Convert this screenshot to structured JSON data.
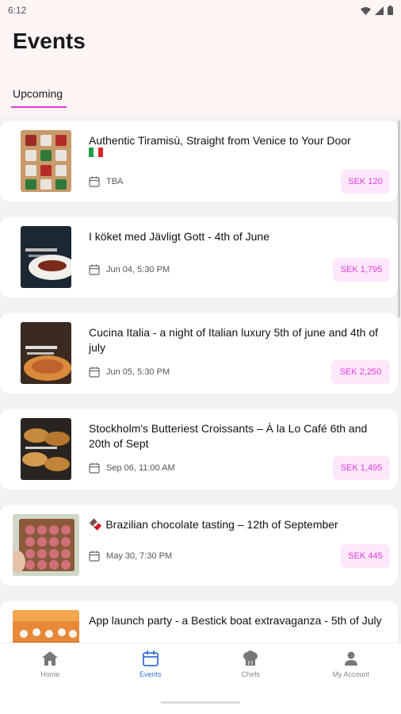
{
  "status_bar": {
    "time": "6:12"
  },
  "header": {
    "title": "Events",
    "tab_label": "Upcoming"
  },
  "events": [
    {
      "title": "Authentic Tiramisù, Straight from Venice to Your Door",
      "flag": "Italy flag",
      "date": "TBA",
      "price": "SEK 120"
    },
    {
      "title": "I köket med Jävligt Gott - 4th of June",
      "date": "Jun 04, 5:30 PM",
      "price": "SEK 1,795"
    },
    {
      "title": "Cucina Italia - a night of Italian luxury 5th of june and 4th of july",
      "date": "Jun 05, 5:30 PM",
      "price": "SEK 2,250"
    },
    {
      "title": "Stockholm's Butteriest Croissants – À la Lo Café 6th and 20th of Sept",
      "date": "Sep 06, 11:00 AM",
      "price": "SEK 1,495"
    },
    {
      "title": "🍫 Brazilian chocolate tasting  – 12th of September",
      "date": "May 30, 7:30 PM",
      "price": "SEK 445"
    },
    {
      "title": "App launch party - a Bestick boat extravaganza - 5th of July"
    }
  ],
  "bottom_nav": [
    {
      "label": "Home",
      "icon": "home-icon"
    },
    {
      "label": "Events",
      "icon": "calendar-icon",
      "active": true
    },
    {
      "label": "Chefs",
      "icon": "chef-hat-icon"
    },
    {
      "label": "My Account",
      "icon": "person-icon"
    }
  ],
  "colors": {
    "accent": "#e23be0",
    "active_nav": "#3b6fd8",
    "price_bg": "#fde8fb",
    "header_bg": "#fdf5f4"
  }
}
